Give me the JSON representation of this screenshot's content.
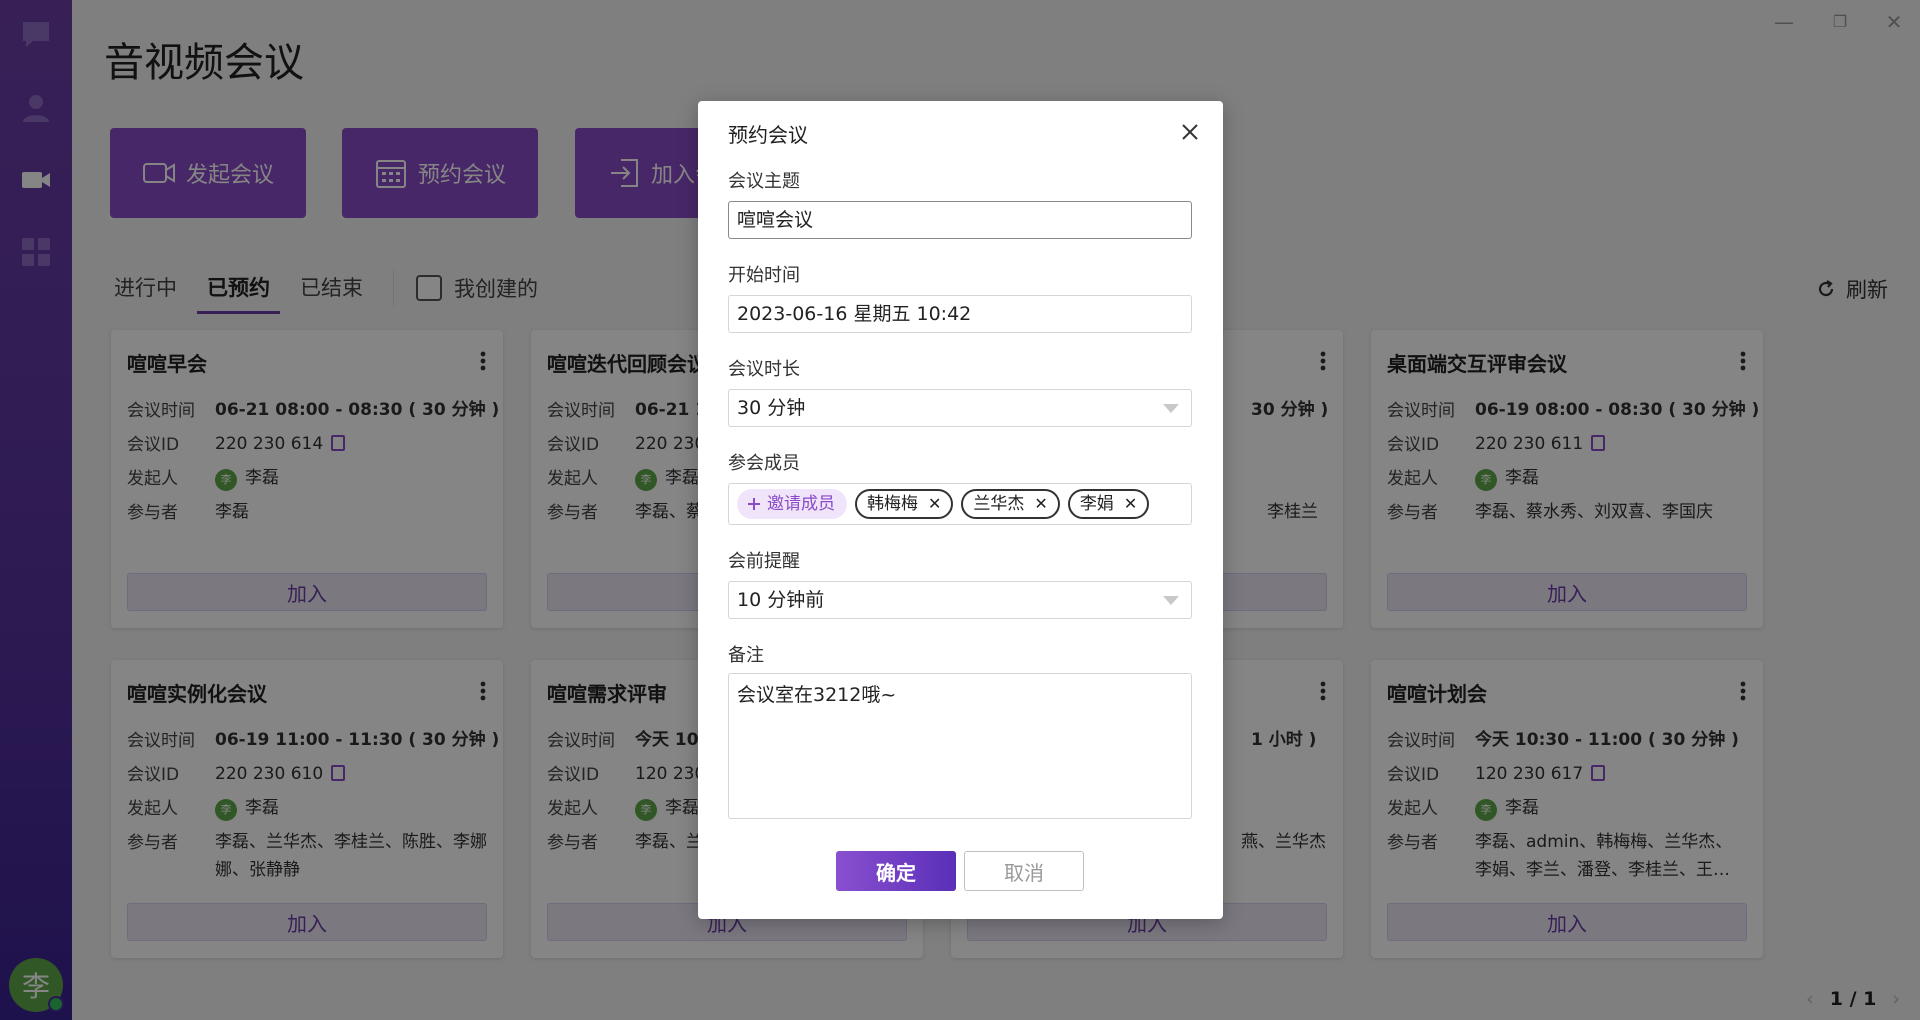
{
  "app": {
    "title": "音视频会议",
    "user_avatar": "李",
    "window_controls": {
      "minimize": "—",
      "restore": "❐",
      "close": "✕"
    }
  },
  "sidebar": {
    "items": [
      {
        "name": "chat",
        "icon": "chat-bubble-icon"
      },
      {
        "name": "contacts",
        "icon": "person-icon"
      },
      {
        "name": "meeting",
        "icon": "video-camera-icon"
      },
      {
        "name": "apps",
        "icon": "grid-apps-icon"
      }
    ]
  },
  "actions": {
    "start": "发起会议",
    "schedule": "预约会议",
    "join": "加入会议"
  },
  "tabs": {
    "ongoing": "进行中",
    "scheduled": "已预约",
    "ended": "已结束",
    "mine": "我创建的",
    "refresh": "刷新"
  },
  "labels": {
    "time": "会议时间",
    "id": "会议ID",
    "host": "发起人",
    "participants": "参与者",
    "join": "加入"
  },
  "cards": [
    {
      "title": "喧喧早会",
      "time": "06-21 08:00 - 08:30 ( 30 分钟 )",
      "id": "220 230 614",
      "host": "李磊",
      "host_avatar": "李",
      "participants": "李磊"
    },
    {
      "title": "喧喧迭代回顾会议",
      "time": "06-21 10:",
      "id": "220 230",
      "host": "李磊",
      "host_avatar": "李",
      "participants": "李磊、蔡"
    },
    {
      "title": "",
      "time": "30 分钟 )",
      "id": "",
      "host": "",
      "host_avatar": "",
      "participants": "李桂兰"
    },
    {
      "title": "桌面端交互评审会议",
      "time": "06-19 08:00 - 08:30 ( 30 分钟 )",
      "id": "220 230 611",
      "host": "李磊",
      "host_avatar": "李",
      "participants": "李磊、蔡水秀、刘双喜、李国庆"
    },
    {
      "title": "喧喧实例化会议",
      "time": "06-19 11:00 - 11:30 ( 30 分钟 )",
      "id": "220 230 610",
      "host": "李磊",
      "host_avatar": "李",
      "participants": "李磊、兰华杰、李桂兰、陈胜、李娜娜、张静静"
    },
    {
      "title": "喧喧需求评审",
      "time": "今天 10:",
      "id": "120 230",
      "host": "李磊",
      "host_avatar": "李",
      "participants": "李磊、兰"
    },
    {
      "title": "",
      "time": "1 小时 )",
      "id": "",
      "host": "",
      "host_avatar": "",
      "participants": "燕、兰华杰"
    },
    {
      "title": "喧喧计划会",
      "time": "今天 10:30 - 11:00 ( 30 分钟 )",
      "id": "120 230 617",
      "host": "李磊",
      "host_avatar": "李",
      "participants": "李磊、admin、韩梅梅、兰华杰、李娟、李兰、潘登、李桂兰、王…"
    }
  ],
  "pager": {
    "text": "1 / 1",
    "prev": "‹",
    "next": "›"
  },
  "dialog": {
    "title": "预约会议",
    "subject_label": "会议主题",
    "subject_value": "喧喧会议",
    "start_label": "开始时间",
    "start_value": "2023-06-16 星期五 10:42",
    "duration_label": "会议时长",
    "duration_value": "30 分钟",
    "members_label": "参会成员",
    "invite_label": "邀请成员",
    "members": [
      "韩梅梅",
      "兰华杰",
      "李娟"
    ],
    "reminder_label": "会前提醒",
    "reminder_value": "10 分钟前",
    "notes_label": "备注",
    "notes_value": "会议室在3212哦~",
    "ok": "确定",
    "cancel": "取消"
  },
  "colors": {
    "brand": "#6b3fa6",
    "button": "#8b4bc8",
    "avatar": "#5fa84a"
  }
}
